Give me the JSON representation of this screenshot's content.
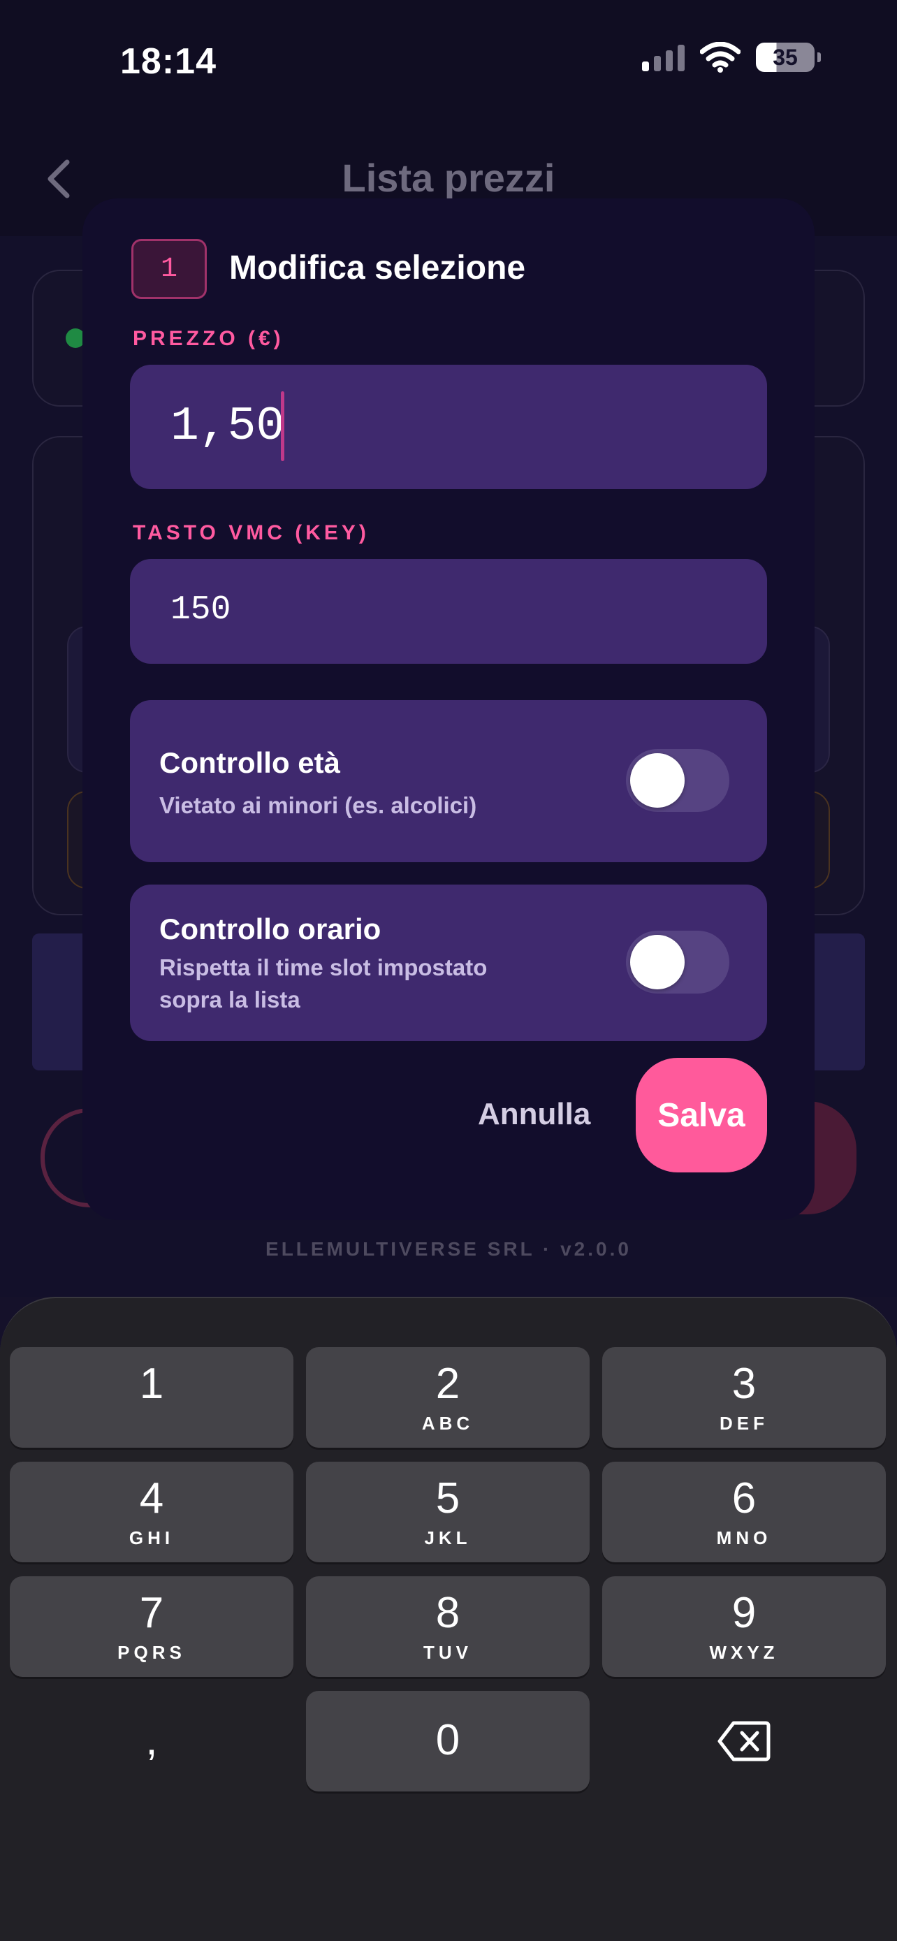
{
  "status_bar": {
    "time": "18:14",
    "battery": "35"
  },
  "background": {
    "title": "Lista prezzi",
    "footer": "ELLEMULTIVERSE SRL · v2.0.0"
  },
  "modal": {
    "badge": "1",
    "title": "Modifica selezione",
    "price": {
      "label": "PREZZO (€)",
      "value": "1,50"
    },
    "key": {
      "label": "TASTO VMC (KEY)",
      "value": "150"
    },
    "age_control": {
      "title": "Controllo età",
      "description": "Vietato ai minori (es. alcolici)",
      "enabled": false
    },
    "time_control": {
      "title": "Controllo orario",
      "description": "Rispetta il time slot impostato sopra la lista",
      "enabled": false
    },
    "cancel_label": "Annulla",
    "save_label": "Salva",
    "colors": {
      "accent": "#ff5a9b",
      "panel": "#120d2c",
      "field": "#3f296e"
    }
  },
  "keyboard": {
    "keys": [
      {
        "num": "1",
        "letters": ""
      },
      {
        "num": "2",
        "letters": "ABC"
      },
      {
        "num": "3",
        "letters": "DEF"
      },
      {
        "num": "4",
        "letters": "GHI"
      },
      {
        "num": "5",
        "letters": "JKL"
      },
      {
        "num": "6",
        "letters": "MNO"
      },
      {
        "num": "7",
        "letters": "PQRS"
      },
      {
        "num": "8",
        "letters": "TUV"
      },
      {
        "num": "9",
        "letters": "WXYZ"
      },
      {
        "num": ","
      },
      {
        "num": "0"
      }
    ],
    "delete_icon": "backspace-icon"
  }
}
